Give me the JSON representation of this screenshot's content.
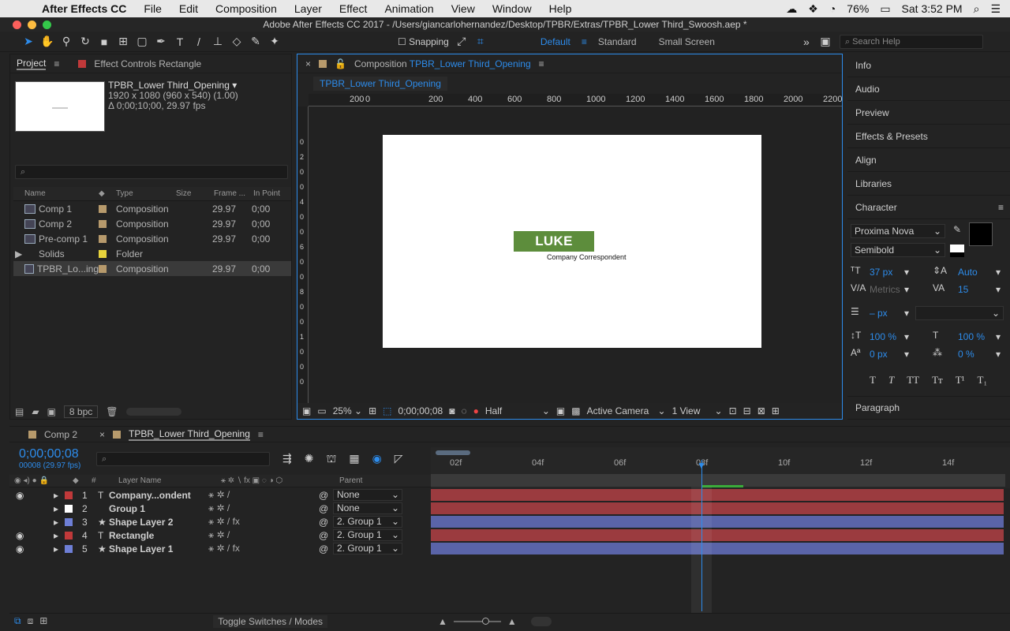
{
  "menubar": {
    "app": "After Effects CC",
    "items": [
      "File",
      "Edit",
      "Composition",
      "Layer",
      "Effect",
      "Animation",
      "View",
      "Window",
      "Help"
    ],
    "battery": "76%",
    "clock": "Sat 3:52 PM"
  },
  "titlebar": {
    "title": "Adobe After Effects CC 2017 - /Users/giancarlohernandez/Desktop/TPBR/Extras/TPBR_Lower Third_Swoosh.aep *"
  },
  "toolbar": {
    "snapping": "Snapping",
    "workspaces": [
      "Default",
      "Standard",
      "Small Screen"
    ],
    "search_placeholder": "Search Help"
  },
  "project": {
    "tab": "Project",
    "effect_tab": "Effect Controls Rectangle",
    "selected_name": "TPBR_Lower Third_Opening ▾",
    "selected_dims": "1920 x 1080  (960 x 540) (1.00)",
    "selected_duration": "Δ 0;00;10;00, 29.97 fps",
    "columns": {
      "name": "Name",
      "type": "Type",
      "size": "Size",
      "frame": "Frame ...",
      "in": "In Point"
    },
    "rows": [
      {
        "name": "Comp 1",
        "type": "Composition",
        "fps": "29.97",
        "in": "0;00",
        "color": "#b79a6c",
        "kind": "comp"
      },
      {
        "name": "Comp 2",
        "type": "Composition",
        "fps": "29.97",
        "in": "0;00",
        "color": "#b79a6c",
        "kind": "comp"
      },
      {
        "name": "Pre-comp 1",
        "type": "Composition",
        "fps": "29.97",
        "in": "0;00",
        "color": "#b79a6c",
        "kind": "comp"
      },
      {
        "name": "Solids",
        "type": "Folder",
        "fps": "",
        "in": "",
        "color": "#e8d43c",
        "kind": "folder"
      },
      {
        "name": "TPBR_Lo...ing",
        "type": "Composition",
        "fps": "29.97",
        "in": "0;00",
        "color": "#b79a6c",
        "kind": "comp",
        "selected": true
      }
    ],
    "bpc": "8 bpc"
  },
  "comp": {
    "tab_label": "Composition",
    "tab_name": "TPBR_Lower Third_Opening",
    "sub_tab": "TPBR_Lower Third_Opening",
    "ruler_ticks": [
      "200",
      "0",
      "200",
      "400",
      "600",
      "800",
      "1000",
      "1200",
      "1400",
      "1600",
      "1800",
      "2000",
      "2200"
    ],
    "ruler_v": [
      "0",
      "2",
      "0",
      "0",
      "4",
      "0",
      "0",
      "6",
      "0",
      "0",
      "8",
      "0",
      "0",
      "1",
      "0",
      "0",
      "0"
    ],
    "title": "LUKE HILLS",
    "subtitle": "Company Correspondent",
    "zoom": "25%",
    "timecode": "0;00;00;08",
    "resolution": "Half",
    "camera": "Active Camera",
    "view": "1 View"
  },
  "right": {
    "panels": [
      "Info",
      "Audio",
      "Preview",
      "Effects & Presets",
      "Align",
      "Libraries"
    ],
    "character": "Character",
    "font": "Proxima Nova",
    "style": "Semibold",
    "size": "37 px",
    "leading": "Auto",
    "kerning": "Metrics",
    "tracking": "15",
    "stroke": "– px",
    "vscale": "100 %",
    "hscale": "100 %",
    "baseline": "0 px",
    "tsume": "0 %",
    "paragraph": "Paragraph"
  },
  "timeline": {
    "tabs": [
      {
        "name": "Comp 2",
        "color": "#b79a6c"
      },
      {
        "name": "TPBR_Lower Third_Opening",
        "color": "#b79a6c"
      }
    ],
    "timecode": "0;00;00;08",
    "fps": "00008 (29.97 fps)",
    "col_layer": "Layer Name",
    "col_parent": "Parent",
    "col_num": "#",
    "ticks": [
      "02f",
      "04f",
      "06f",
      "08f",
      "10f",
      "12f",
      "14f"
    ],
    "layers": [
      {
        "num": "1",
        "name": "Company...ondent",
        "type": "T",
        "color": "#c0393a",
        "parent": "None",
        "eye": true,
        "fx": false
      },
      {
        "num": "2",
        "name": "Group 1",
        "type": "",
        "color": "#ffffff",
        "parent": "None",
        "eye": false,
        "fx": false
      },
      {
        "num": "3",
        "name": "Shape Layer 2",
        "type": "★",
        "color": "#6e7fd6",
        "parent": "2. Group 1",
        "eye": false,
        "fx": true
      },
      {
        "num": "4",
        "name": "Rectangle",
        "type": "T",
        "color": "#c0393a",
        "parent": "2. Group 1",
        "eye": true,
        "fx": false
      },
      {
        "num": "5",
        "name": "Shape Layer 1",
        "type": "★",
        "color": "#6e7fd6",
        "parent": "2. Group 1",
        "eye": true,
        "fx": true
      }
    ],
    "toggle": "Toggle Switches / Modes"
  }
}
